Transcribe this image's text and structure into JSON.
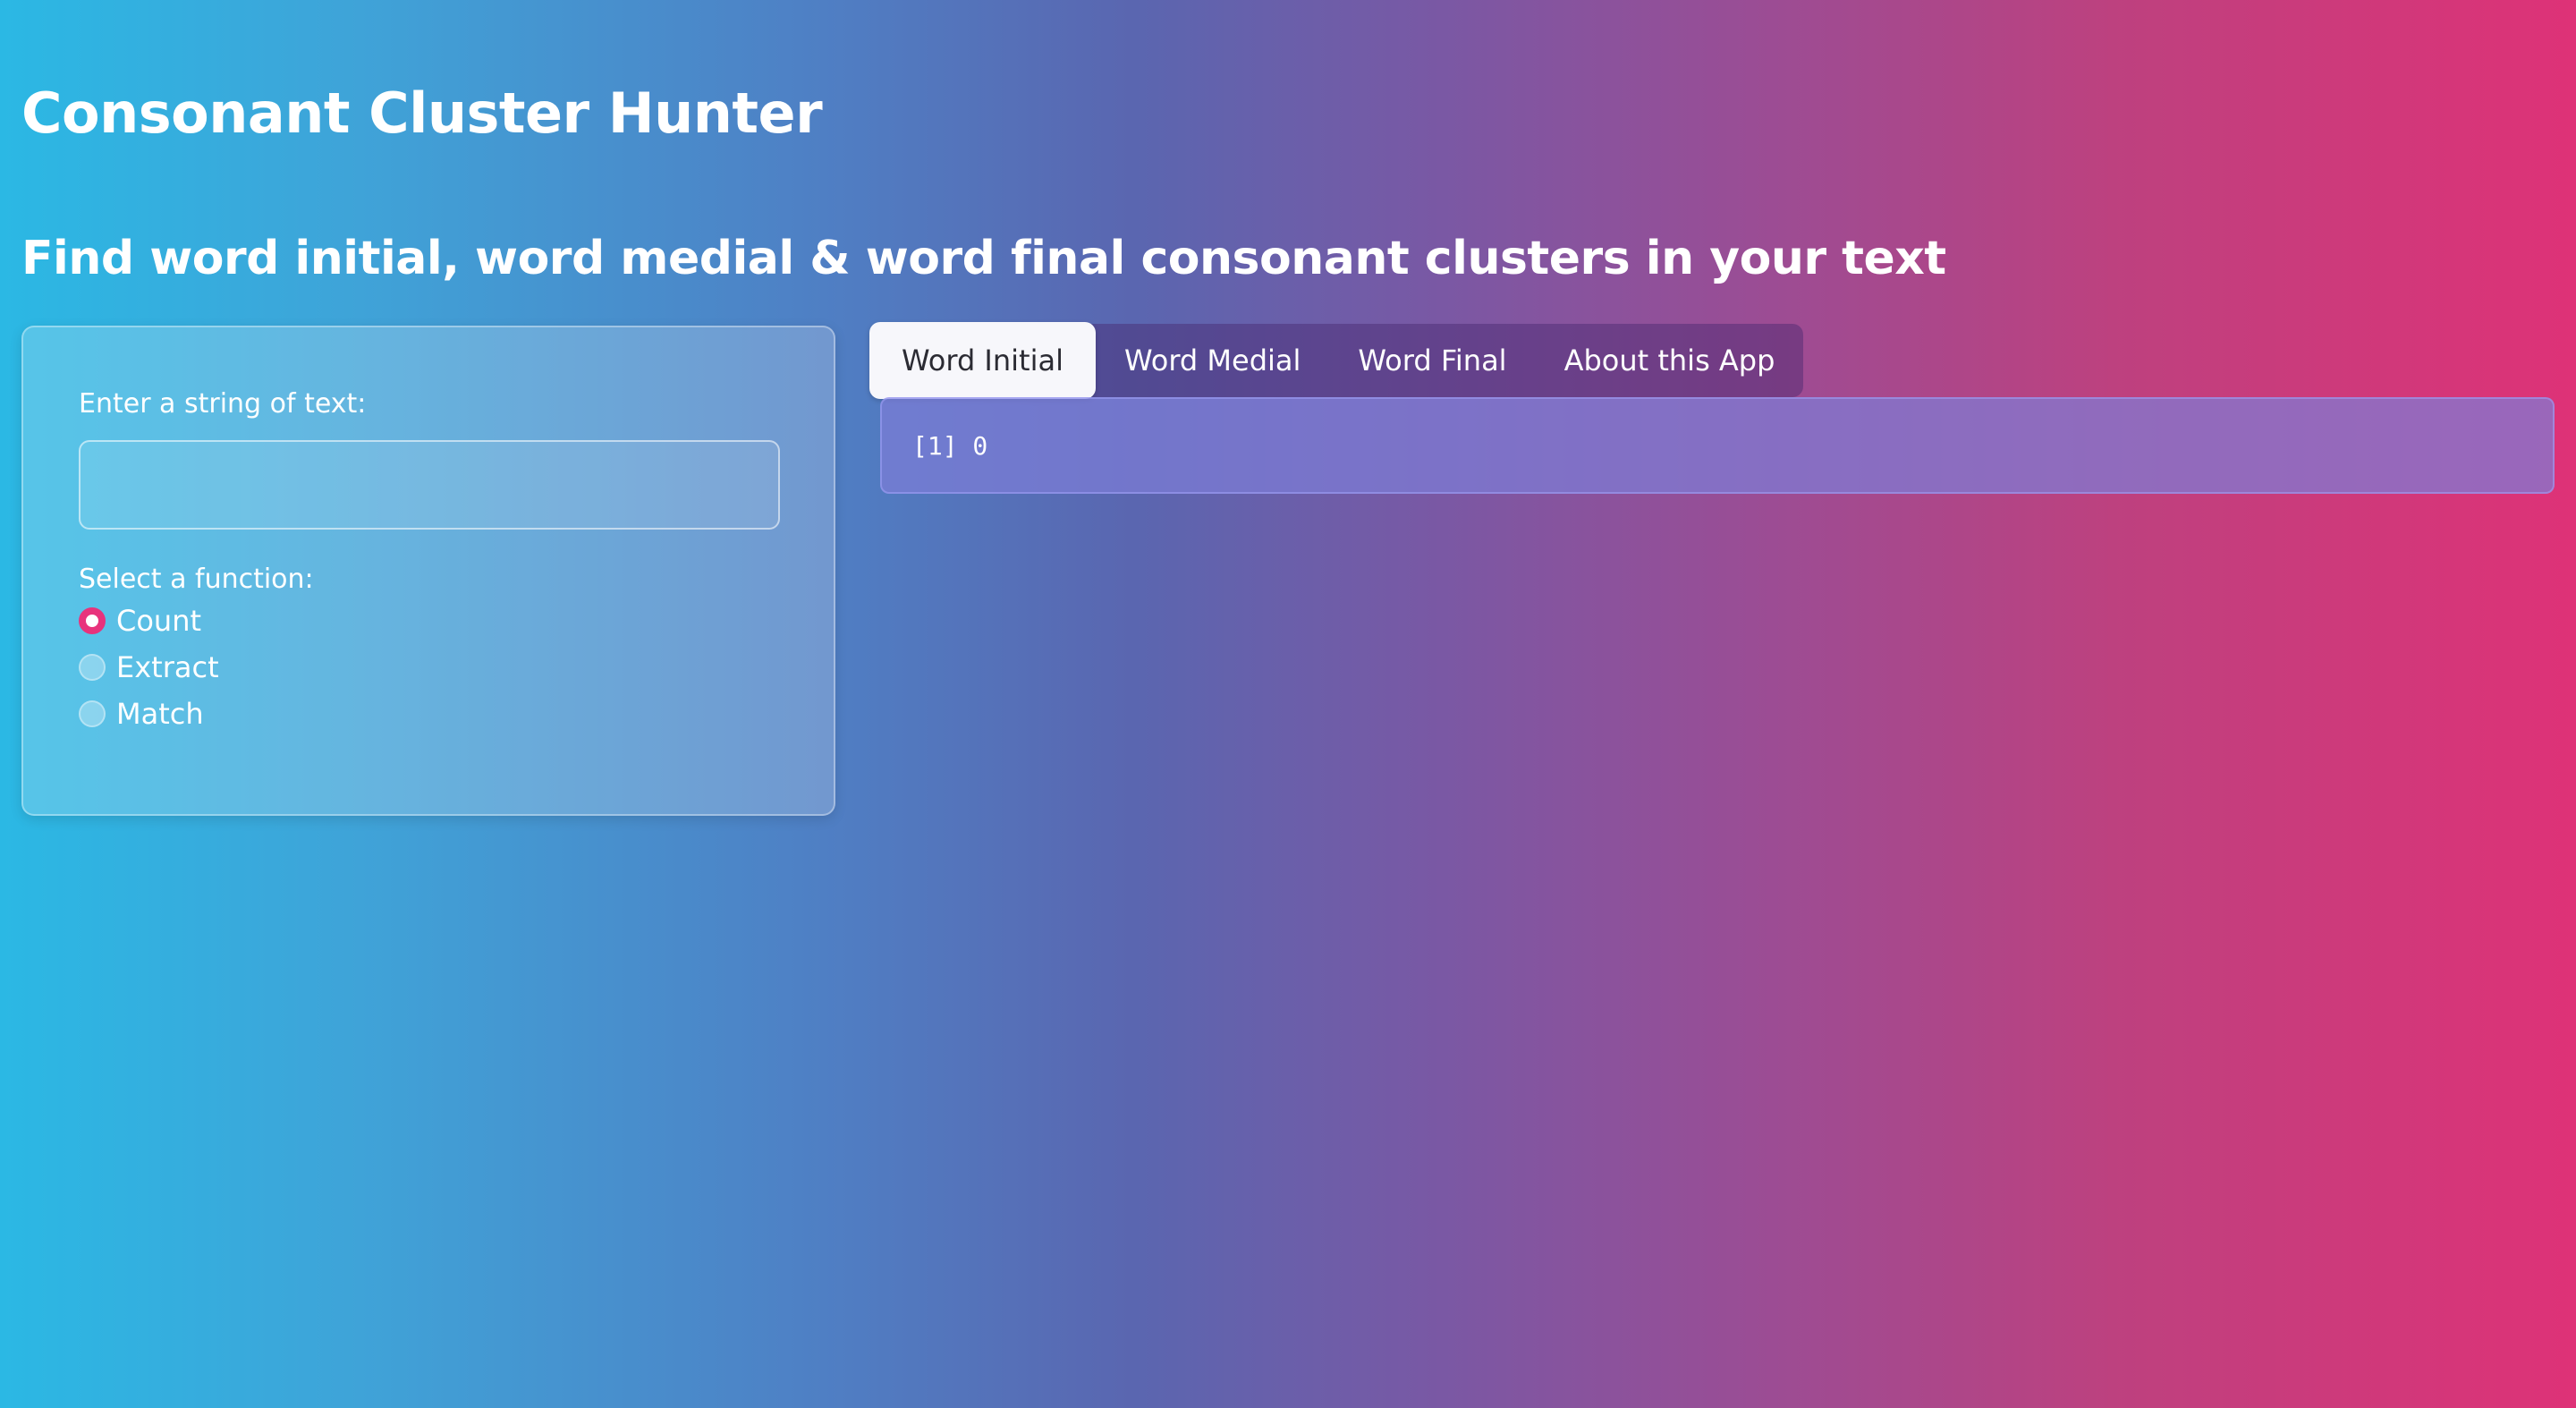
{
  "app": {
    "title": "Consonant Cluster Hunter",
    "subtitle": "Find word initial, word medial & word final consonant clusters in your text"
  },
  "sidebar": {
    "input_label": "Enter a string of text:",
    "input_value": "",
    "input_placeholder": "",
    "function_label": "Select a function:",
    "options": [
      {
        "label": "Count",
        "selected": true
      },
      {
        "label": "Extract",
        "selected": false
      },
      {
        "label": "Match",
        "selected": false
      }
    ]
  },
  "tabs": [
    {
      "label": "Word Initial",
      "active": true
    },
    {
      "label": "Word Medial",
      "active": false
    },
    {
      "label": "Word Final",
      "active": false
    },
    {
      "label": "About this App",
      "active": false
    }
  ],
  "output": {
    "text": "[1] 0"
  },
  "colors": {
    "accent": "#e8337c",
    "gradient_start": "#2bb8e4",
    "gradient_end": "#de3277"
  }
}
